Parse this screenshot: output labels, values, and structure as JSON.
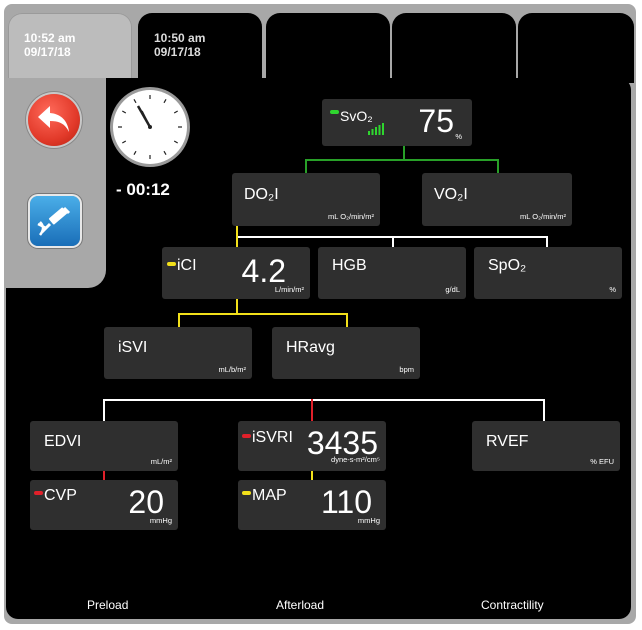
{
  "tabs": [
    {
      "time": "10:52 am",
      "date": "09/17/18"
    },
    {
      "time": "10:50 am",
      "date": "09/17/18"
    },
    {
      "time": "",
      "date": ""
    },
    {
      "time": "",
      "date": ""
    },
    {
      "time": "",
      "date": ""
    }
  ],
  "controls": {
    "back_icon": "back-arrow-icon",
    "tool_icon": "syringe-icon",
    "countdown": "- 00:12",
    "back_color": "#e23a2a",
    "tool_color": "#2a8ad4"
  },
  "params": {
    "svo2": {
      "label": "SvO₂",
      "value": "75",
      "unit": "%",
      "indicator": "#2fd62f"
    },
    "do2i": {
      "label": "DO₂I",
      "value": "",
      "unit": "mL O₂/min/m²"
    },
    "vo2i": {
      "label": "VO₂I",
      "value": "",
      "unit": "mL O₂/min/m²"
    },
    "ici": {
      "label": "iCI",
      "value": "4.2",
      "unit": "L/min/m²",
      "indicator": "#f2e01a"
    },
    "hgb": {
      "label": "HGB",
      "value": "",
      "unit": "g/dL"
    },
    "spo2": {
      "label": "SpO₂",
      "value": "",
      "unit": "%"
    },
    "isvi": {
      "label": "iSVI",
      "value": "",
      "unit": "mL/b/m²"
    },
    "hravg": {
      "label": "HRavg",
      "value": "",
      "unit": "bpm"
    },
    "edvi": {
      "label": "EDVI",
      "value": "",
      "unit": "mL/m²"
    },
    "isvri": {
      "label": "iSVRI",
      "value": "3435",
      "unit": "dyne-s-m²/cm⁵",
      "indicator": "#e0202a"
    },
    "rvef": {
      "label": "RVEF",
      "value": "",
      "unit": "% EFU"
    },
    "cvp": {
      "label": "CVP",
      "value": "20",
      "unit": "mmHg",
      "indicator": "#e0202a"
    },
    "map": {
      "label": "MAP",
      "value": "110",
      "unit": "mmHg",
      "indicator": "#f2e01a"
    }
  },
  "footer": {
    "preload": "Preload",
    "afterload": "Afterload",
    "contractility": "Contractility"
  }
}
